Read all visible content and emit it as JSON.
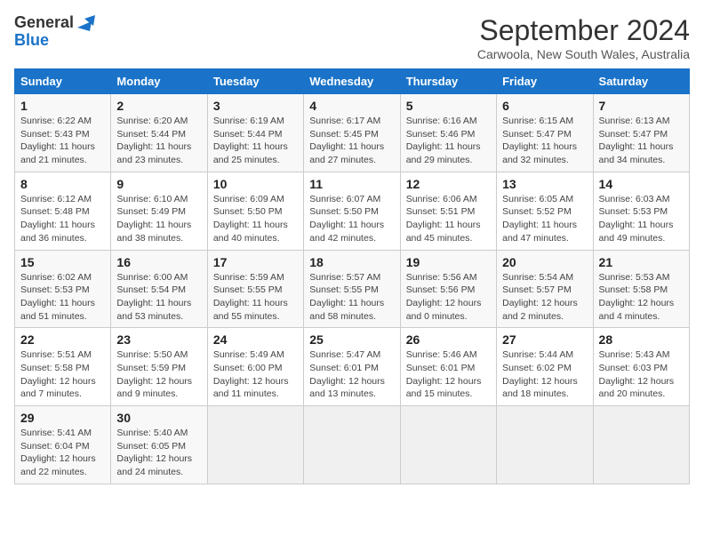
{
  "header": {
    "logo_line1": "General",
    "logo_line2": "Blue",
    "title": "September 2024",
    "subtitle": "Carwoola, New South Wales, Australia"
  },
  "days_of_week": [
    "Sunday",
    "Monday",
    "Tuesday",
    "Wednesday",
    "Thursday",
    "Friday",
    "Saturday"
  ],
  "weeks": [
    [
      {
        "day": "1",
        "sunrise": "6:22 AM",
        "sunset": "5:43 PM",
        "daylight": "11 hours and 21 minutes."
      },
      {
        "day": "2",
        "sunrise": "6:20 AM",
        "sunset": "5:44 PM",
        "daylight": "11 hours and 23 minutes."
      },
      {
        "day": "3",
        "sunrise": "6:19 AM",
        "sunset": "5:44 PM",
        "daylight": "11 hours and 25 minutes."
      },
      {
        "day": "4",
        "sunrise": "6:17 AM",
        "sunset": "5:45 PM",
        "daylight": "11 hours and 27 minutes."
      },
      {
        "day": "5",
        "sunrise": "6:16 AM",
        "sunset": "5:46 PM",
        "daylight": "11 hours and 29 minutes."
      },
      {
        "day": "6",
        "sunrise": "6:15 AM",
        "sunset": "5:47 PM",
        "daylight": "11 hours and 32 minutes."
      },
      {
        "day": "7",
        "sunrise": "6:13 AM",
        "sunset": "5:47 PM",
        "daylight": "11 hours and 34 minutes."
      }
    ],
    [
      {
        "day": "8",
        "sunrise": "6:12 AM",
        "sunset": "5:48 PM",
        "daylight": "11 hours and 36 minutes."
      },
      {
        "day": "9",
        "sunrise": "6:10 AM",
        "sunset": "5:49 PM",
        "daylight": "11 hours and 38 minutes."
      },
      {
        "day": "10",
        "sunrise": "6:09 AM",
        "sunset": "5:50 PM",
        "daylight": "11 hours and 40 minutes."
      },
      {
        "day": "11",
        "sunrise": "6:07 AM",
        "sunset": "5:50 PM",
        "daylight": "11 hours and 42 minutes."
      },
      {
        "day": "12",
        "sunrise": "6:06 AM",
        "sunset": "5:51 PM",
        "daylight": "11 hours and 45 minutes."
      },
      {
        "day": "13",
        "sunrise": "6:05 AM",
        "sunset": "5:52 PM",
        "daylight": "11 hours and 47 minutes."
      },
      {
        "day": "14",
        "sunrise": "6:03 AM",
        "sunset": "5:53 PM",
        "daylight": "11 hours and 49 minutes."
      }
    ],
    [
      {
        "day": "15",
        "sunrise": "6:02 AM",
        "sunset": "5:53 PM",
        "daylight": "11 hours and 51 minutes."
      },
      {
        "day": "16",
        "sunrise": "6:00 AM",
        "sunset": "5:54 PM",
        "daylight": "11 hours and 53 minutes."
      },
      {
        "day": "17",
        "sunrise": "5:59 AM",
        "sunset": "5:55 PM",
        "daylight": "11 hours and 55 minutes."
      },
      {
        "day": "18",
        "sunrise": "5:57 AM",
        "sunset": "5:55 PM",
        "daylight": "11 hours and 58 minutes."
      },
      {
        "day": "19",
        "sunrise": "5:56 AM",
        "sunset": "5:56 PM",
        "daylight": "12 hours and 0 minutes."
      },
      {
        "day": "20",
        "sunrise": "5:54 AM",
        "sunset": "5:57 PM",
        "daylight": "12 hours and 2 minutes."
      },
      {
        "day": "21",
        "sunrise": "5:53 AM",
        "sunset": "5:58 PM",
        "daylight": "12 hours and 4 minutes."
      }
    ],
    [
      {
        "day": "22",
        "sunrise": "5:51 AM",
        "sunset": "5:58 PM",
        "daylight": "12 hours and 7 minutes."
      },
      {
        "day": "23",
        "sunrise": "5:50 AM",
        "sunset": "5:59 PM",
        "daylight": "12 hours and 9 minutes."
      },
      {
        "day": "24",
        "sunrise": "5:49 AM",
        "sunset": "6:00 PM",
        "daylight": "12 hours and 11 minutes."
      },
      {
        "day": "25",
        "sunrise": "5:47 AM",
        "sunset": "6:01 PM",
        "daylight": "12 hours and 13 minutes."
      },
      {
        "day": "26",
        "sunrise": "5:46 AM",
        "sunset": "6:01 PM",
        "daylight": "12 hours and 15 minutes."
      },
      {
        "day": "27",
        "sunrise": "5:44 AM",
        "sunset": "6:02 PM",
        "daylight": "12 hours and 18 minutes."
      },
      {
        "day": "28",
        "sunrise": "5:43 AM",
        "sunset": "6:03 PM",
        "daylight": "12 hours and 20 minutes."
      }
    ],
    [
      {
        "day": "29",
        "sunrise": "5:41 AM",
        "sunset": "6:04 PM",
        "daylight": "12 hours and 22 minutes."
      },
      {
        "day": "30",
        "sunrise": "5:40 AM",
        "sunset": "6:05 PM",
        "daylight": "12 hours and 24 minutes."
      },
      null,
      null,
      null,
      null,
      null
    ]
  ],
  "labels": {
    "sunrise": "Sunrise:",
    "sunset": "Sunset:",
    "daylight": "Daylight:"
  }
}
